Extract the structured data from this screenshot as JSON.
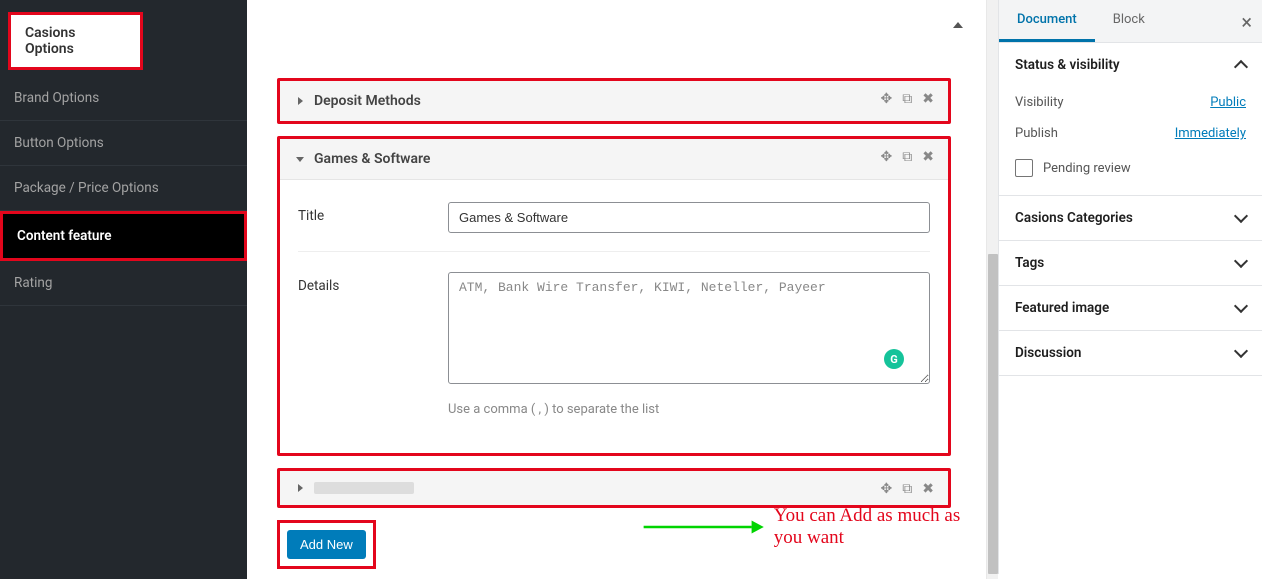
{
  "sidebar": {
    "title": "Casions Options",
    "items": [
      {
        "label": "Brand Options"
      },
      {
        "label": "Button Options"
      },
      {
        "label": "Package / Price Options"
      },
      {
        "label": "Content feature"
      },
      {
        "label": "Rating"
      }
    ],
    "active_index": 3
  },
  "panels": {
    "deposit": {
      "title": "Deposit Methods"
    },
    "games": {
      "title": "Games & Software",
      "fields": {
        "title_label": "Title",
        "title_value": "Games & Software",
        "details_label": "Details",
        "details_placeholder": "ATM, Bank Wire Transfer, KIWI, Neteller, Payeer",
        "hint": "Use a comma ( , ) to separate the list"
      }
    }
  },
  "add_new_label": "Add New",
  "annotation": "You can Add as much as you want",
  "inspector": {
    "tabs": {
      "document": "Document",
      "block": "Block"
    },
    "status": {
      "heading": "Status & visibility",
      "visibility_label": "Visibility",
      "visibility_value": "Public",
      "publish_label": "Publish",
      "publish_value": "Immediately",
      "pending_label": "Pending review"
    },
    "sections": {
      "categories": "Casions Categories",
      "tags": "Tags",
      "featured": "Featured image",
      "discussion": "Discussion"
    }
  }
}
